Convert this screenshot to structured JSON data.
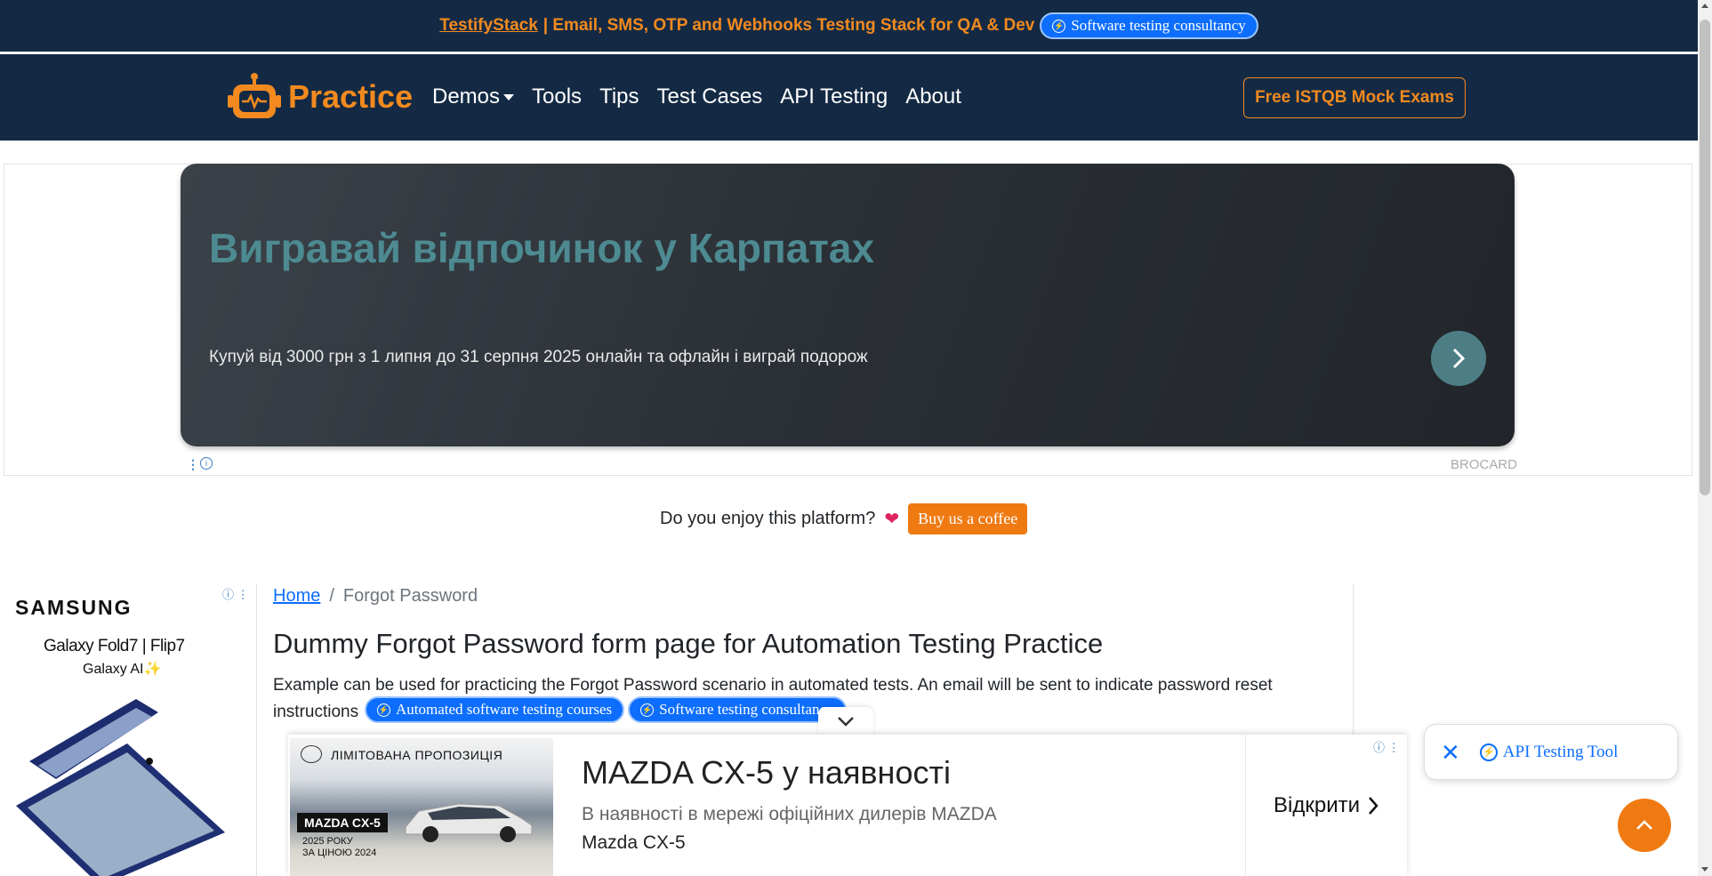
{
  "top_banner": {
    "brand_link": "TestifyStack",
    "tagline": "| Email, SMS, OTP and Webhooks Testing Stack for QA & Dev",
    "pill": "Software testing consultancy"
  },
  "navbar": {
    "brand": "Practice",
    "items": [
      "Demos",
      "Tools",
      "Tips",
      "Test Cases",
      "API Testing",
      "About"
    ],
    "cta": "Free ISTQB Mock Exams"
  },
  "ad_top": {
    "title": "Вигравай відпочинок у Карпатах",
    "subtitle": "Купуй від 3000 грн з 1 липня до 31 серпня 2025 онлайн та офлайн і виграй подорож",
    "brand": "BROCARD"
  },
  "coffee": {
    "text": "Do you enjoy this platform?",
    "button": "Buy us a coffee"
  },
  "left_ad": {
    "brand": "SAMSUNG",
    "product": "Galaxy Fold7 | Flip7",
    "tagline": "Galaxy AI✨"
  },
  "breadcrumb": {
    "home": "Home",
    "separator": "/",
    "current": "Forgot Password"
  },
  "main": {
    "heading": "Dummy Forgot Password form page for Automation Testing Practice",
    "description": "Example can be used for practicing the Forgot Password scenario in automated tests. An email will be sent to indicate password reset instructions",
    "pills": [
      "Automated software testing courses",
      "Software testing consultancy"
    ]
  },
  "bottom_ad": {
    "image_tag": "ЛІМІТОВАНА ПРОПОЗИЦІЯ",
    "image_badge": "MAZDA CX-5",
    "image_small": "2025 РОКУ\nЗА ЦІНОЮ 2024",
    "title": "MAZDA CX-5 у наявності",
    "subtitle": "В наявності в мережі офіційних дилерів MAZDA",
    "name": "Mazda CX-5",
    "open": "Відкрити"
  },
  "floating": {
    "api_tool": "API Testing Tool"
  },
  "colors": {
    "navy": "#142a44",
    "orange": "#f28a1f",
    "blue": "#0d6efd",
    "ad_teal": "#4d8a91"
  }
}
